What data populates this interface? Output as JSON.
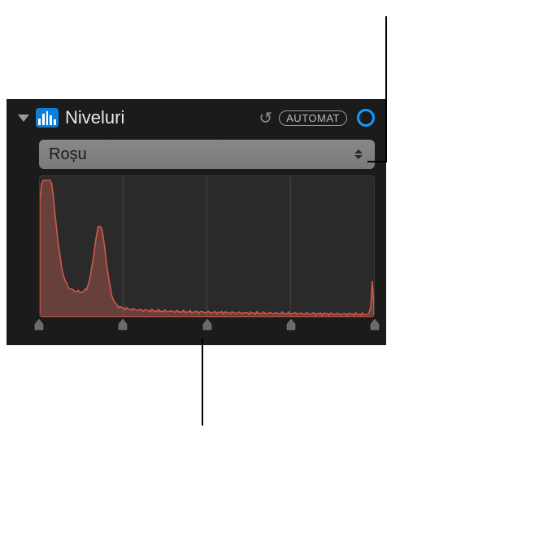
{
  "panel": {
    "title": "Niveluri",
    "autoButton": "AUTOMAT"
  },
  "dropdown": {
    "selected": "Roșu"
  },
  "histogram": {
    "channel": "red",
    "color": "#d6584a",
    "fillColor": "rgba(180, 90, 80, 0.45)",
    "gridPositions": [
      0,
      25,
      50,
      75,
      100
    ]
  },
  "sliders": {
    "handles": [
      {
        "position": 0,
        "type": "black-point"
      },
      {
        "position": 25,
        "type": "shadows"
      },
      {
        "position": 50,
        "type": "midtones"
      },
      {
        "position": 75,
        "type": "highlights"
      },
      {
        "position": 100,
        "type": "white-point"
      }
    ]
  }
}
